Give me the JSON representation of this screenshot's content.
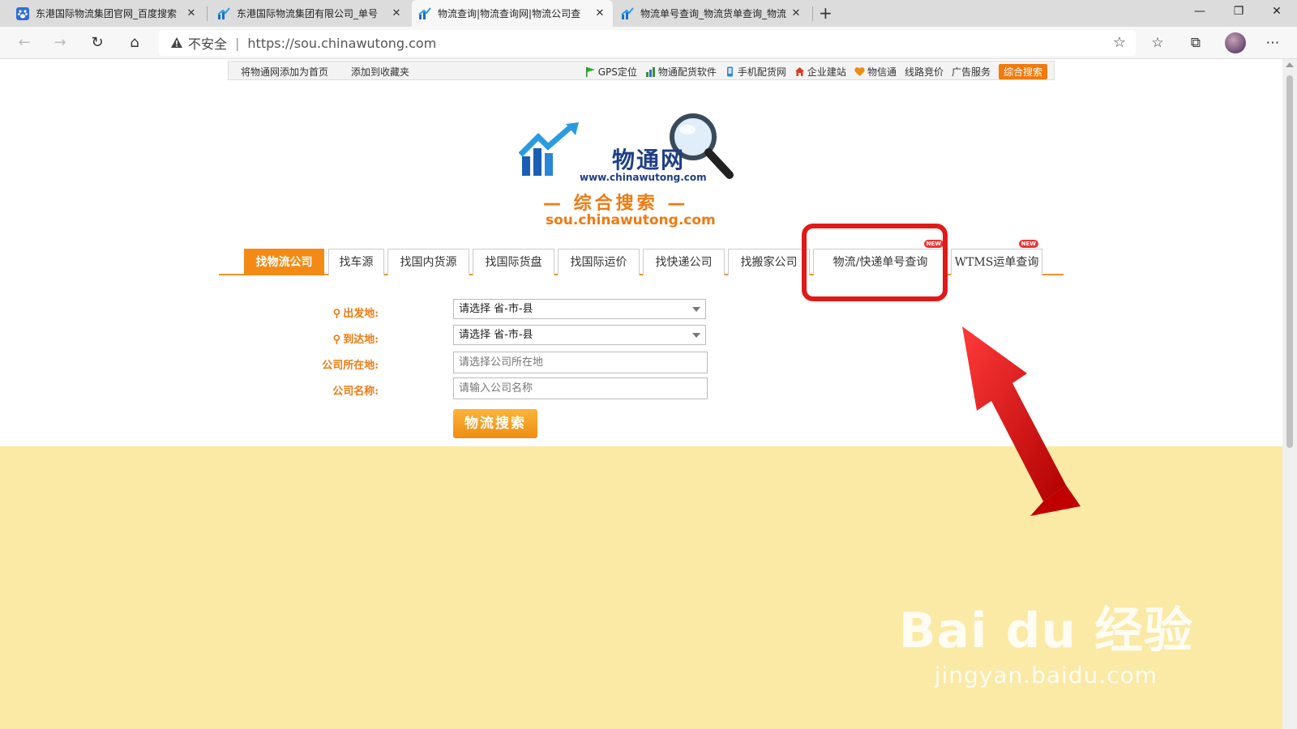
{
  "browser": {
    "tabs": [
      {
        "title": "东港国际物流集团官网_百度搜索",
        "favicon": "baidu-paw-icon"
      },
      {
        "title": "东港国际物流集团有限公司_单号",
        "favicon": "chinawutong-chart-icon"
      },
      {
        "title": "物流查询|物流查询网|物流公司查",
        "favicon": "chinawutong-chart-icon"
      },
      {
        "title": "物流单号查询_物流货单查询_物流",
        "favicon": "chinawutong-chart-icon"
      }
    ],
    "active_tab_index": 2,
    "security_label": "不安全",
    "url": "https://sou.chinawutong.com"
  },
  "topnav": {
    "left_links": [
      "将物通网添加为首页",
      "添加到收藏夹"
    ],
    "right_links": [
      "GPS定位",
      "物通配货软件",
      "手机配货网",
      "企业建站",
      "物信通",
      "线路竞价",
      "广告服务"
    ],
    "hot_button": "综合搜索"
  },
  "logo": {
    "main": "物通网",
    "url": "www.chinawutong.com",
    "sub": "— 综合搜索 —",
    "domain": "sou.chinawutong.com"
  },
  "search_tabs": [
    {
      "label": "找物流公司",
      "active": true
    },
    {
      "label": "找车源"
    },
    {
      "label": "找国内货源"
    },
    {
      "label": "找国际货盘"
    },
    {
      "label": "找国际运价"
    },
    {
      "label": "找快递公司"
    },
    {
      "label": "找搬家公司"
    },
    {
      "label": "物流/快递单号查询",
      "new": true
    },
    {
      "label": "WTMS运单查询",
      "new": true
    }
  ],
  "new_badge": "NEW",
  "form": {
    "origin_label": "出发地:",
    "origin_value": "请选择 省-市-县",
    "dest_label": "到达地:",
    "dest_value": "请选择 省-市-县",
    "location_label": "公司所在地:",
    "location_placeholder": "请选择公司所在地",
    "name_label": "公司名称:",
    "name_placeholder": "请输入公司名称",
    "search_button": "物流搜索"
  },
  "watermark": {
    "main": "Bai du 经验",
    "sub": "jingyan.baidu.com"
  },
  "colors": {
    "accent": "#f48a16",
    "annotation": "#e01919",
    "bottom_bg": "#fbe9a6"
  }
}
